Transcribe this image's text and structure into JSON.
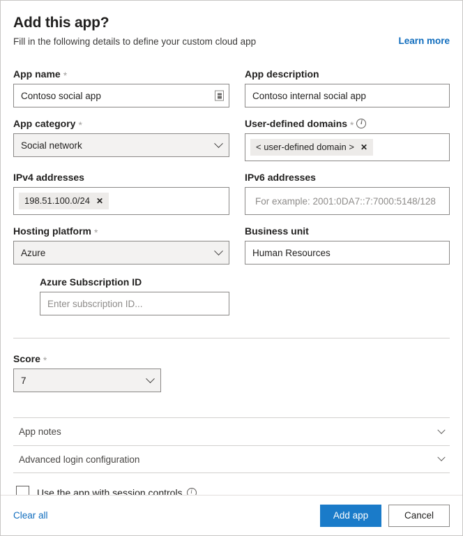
{
  "header": {
    "title": "Add this app?",
    "subtitle": "Fill in the following details to define your custom cloud app",
    "learn_more": "Learn more"
  },
  "form": {
    "app_name": {
      "label": "App name",
      "required": "*",
      "value": "Contoso social app",
      "icon": "ime-input-mode-icon"
    },
    "app_description": {
      "label": "App description",
      "value": "Contoso internal social app"
    },
    "app_category": {
      "label": "App category",
      "required": "*",
      "selected": "Social network"
    },
    "user_defined_domains": {
      "label": "User-defined domains",
      "required": "*",
      "info": "info-icon",
      "chips": [
        {
          "text": "< user-defined domain >",
          "remove": "✕"
        }
      ]
    },
    "ipv4_addresses": {
      "label": "IPv4 addresses",
      "chips": [
        {
          "text": "198.51.100.0/24",
          "remove": "✕"
        }
      ]
    },
    "ipv6_addresses": {
      "label": "IPv6 addresses",
      "placeholder": "For example: 2001:0DA7::7:7000:5148/128",
      "value": ""
    },
    "hosting_platform": {
      "label": "Hosting platform",
      "required": "*",
      "selected": "Azure"
    },
    "business_unit": {
      "label": "Business unit",
      "value": "Human Resources"
    },
    "azure_subscription_id": {
      "label": "Azure Subscription ID",
      "placeholder": "Enter subscription ID...",
      "value": ""
    },
    "score": {
      "label": "Score",
      "required": "*",
      "selected": "7"
    }
  },
  "accordions": [
    {
      "label": "App notes"
    },
    {
      "label": "Advanced login configuration"
    }
  ],
  "session_controls": {
    "label": "Use the app with session controls",
    "checked": false,
    "info": "info-icon"
  },
  "footer": {
    "clear_all": "Clear all",
    "primary": "Add app",
    "secondary": "Cancel"
  },
  "colors": {
    "accent": "#1a7bc9",
    "link": "#0f6cbd",
    "border": "#8a8886",
    "chip_bg": "#edebe9",
    "select_bg": "#f3f2f1"
  }
}
